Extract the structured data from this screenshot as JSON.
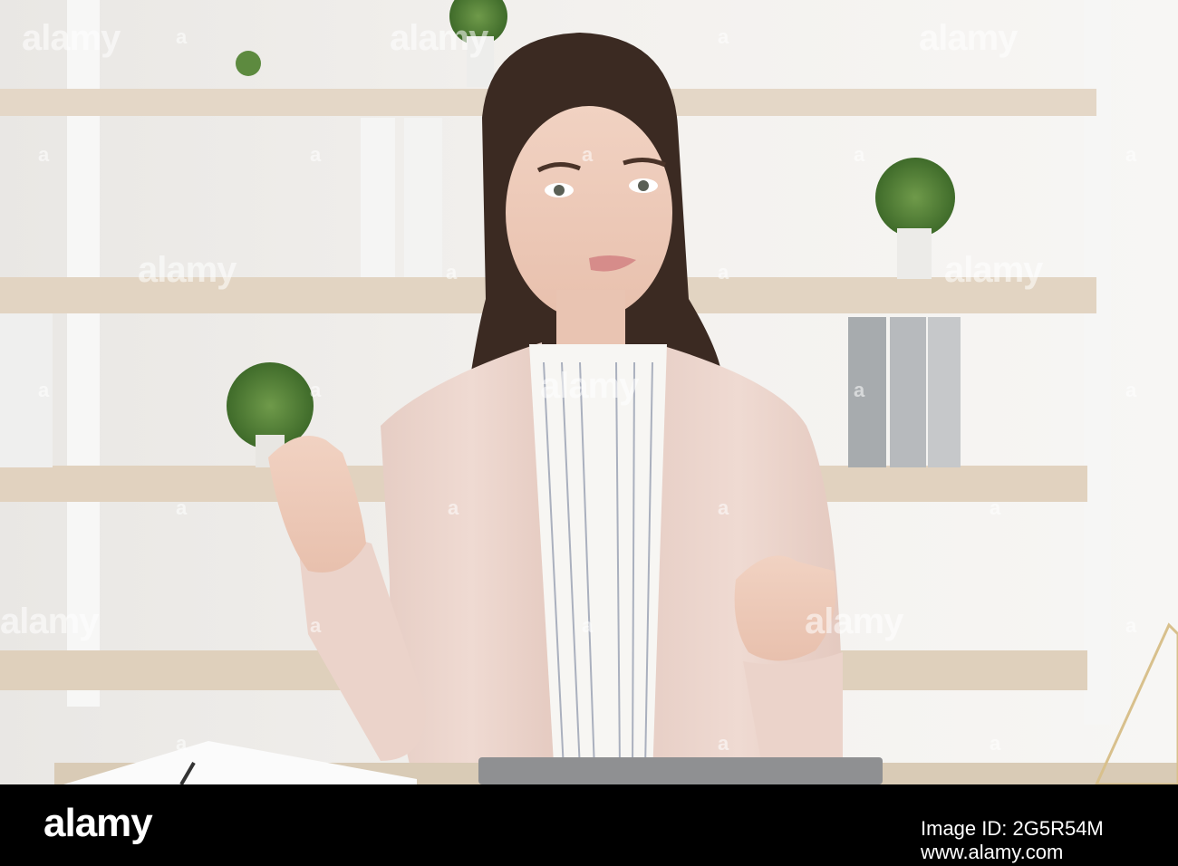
{
  "watermark": {
    "brand": "alamy",
    "letter": "a"
  },
  "footer": {
    "brand": "alamy",
    "image_id": "Image ID: 2G5R54M",
    "url": "www.alamy.com"
  },
  "colors": {
    "background": "#f1efec",
    "shelf": "#e3d6c5",
    "blazer": "#ecd6ce",
    "hair": "#3b2a22",
    "footer": "#000000"
  }
}
